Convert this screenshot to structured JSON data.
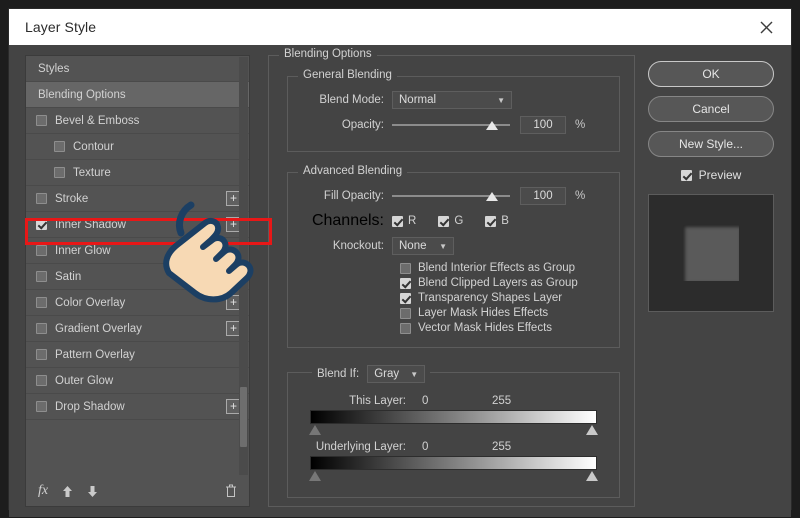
{
  "window": {
    "title": "Layer Style",
    "close_icon": "close-icon"
  },
  "sidebar": {
    "items": [
      {
        "label": "Styles",
        "checkbox": "none",
        "indent": false,
        "plus": false,
        "selected": false
      },
      {
        "label": "Blending Options",
        "checkbox": "none",
        "indent": false,
        "plus": false,
        "selected": true
      },
      {
        "label": "Bevel & Emboss",
        "checkbox": "unchecked",
        "indent": false,
        "plus": false,
        "selected": false
      },
      {
        "label": "Contour",
        "checkbox": "unchecked",
        "indent": true,
        "plus": false,
        "selected": false
      },
      {
        "label": "Texture",
        "checkbox": "unchecked",
        "indent": true,
        "plus": false,
        "selected": false
      },
      {
        "label": "Stroke",
        "checkbox": "unchecked",
        "indent": false,
        "plus": true,
        "selected": false
      },
      {
        "label": "Inner Shadow",
        "checkbox": "checked",
        "indent": false,
        "plus": true,
        "selected": false
      },
      {
        "label": "Inner Glow",
        "checkbox": "unchecked",
        "indent": false,
        "plus": false,
        "selected": false
      },
      {
        "label": "Satin",
        "checkbox": "unchecked",
        "indent": false,
        "plus": false,
        "selected": false
      },
      {
        "label": "Color Overlay",
        "checkbox": "unchecked",
        "indent": false,
        "plus": true,
        "selected": false
      },
      {
        "label": "Gradient Overlay",
        "checkbox": "unchecked",
        "indent": false,
        "plus": true,
        "selected": false
      },
      {
        "label": "Pattern Overlay",
        "checkbox": "unchecked",
        "indent": false,
        "plus": false,
        "selected": false
      },
      {
        "label": "Outer Glow",
        "checkbox": "unchecked",
        "indent": false,
        "plus": false,
        "selected": false
      },
      {
        "label": "Drop Shadow",
        "checkbox": "unchecked",
        "indent": false,
        "plus": true,
        "selected": false
      }
    ],
    "plus_label": "+",
    "footer": {
      "fx_label": "fx",
      "move_up_icon": "arrow-up-icon",
      "move_down_icon": "arrow-down-icon",
      "delete_icon": "trash-icon"
    }
  },
  "options": {
    "legend": "Blending Options",
    "general": {
      "legend": "General Blending",
      "blend_mode_label": "Blend Mode:",
      "blend_mode_value": "Normal",
      "opacity_label": "Opacity:",
      "opacity_value": "100",
      "opacity_pct": "%"
    },
    "advanced": {
      "legend": "Advanced Blending",
      "fill_opacity_label": "Fill Opacity:",
      "fill_opacity_value": "100",
      "fill_opacity_pct": "%",
      "channels_label": "Channels:",
      "channels": [
        {
          "label": "R",
          "checked": true
        },
        {
          "label": "G",
          "checked": true
        },
        {
          "label": "B",
          "checked": true
        }
      ],
      "knockout_label": "Knockout:",
      "knockout_value": "None",
      "toggles": [
        {
          "label": "Blend Interior Effects as Group",
          "checked": false
        },
        {
          "label": "Blend Clipped Layers as Group",
          "checked": true
        },
        {
          "label": "Transparency Shapes Layer",
          "checked": true
        },
        {
          "label": "Layer Mask Hides Effects",
          "checked": false
        },
        {
          "label": "Vector Mask Hides Effects",
          "checked": false
        }
      ]
    },
    "blend_if": {
      "label": "Blend If:",
      "channel_value": "Gray",
      "ramps": [
        {
          "name": "This Layer:",
          "min": "0",
          "max": "255"
        },
        {
          "name": "Underlying Layer:",
          "min": "0",
          "max": "255"
        }
      ]
    }
  },
  "actions": {
    "ok": "OK",
    "cancel": "Cancel",
    "new_style": "New Style...",
    "preview_label": "Preview",
    "preview_checked": true
  },
  "annotation": {
    "highlight_color": "#e81717",
    "cursor_icon": "pointing-hand-cursor",
    "highlighted_item": "Inner Shadow"
  }
}
